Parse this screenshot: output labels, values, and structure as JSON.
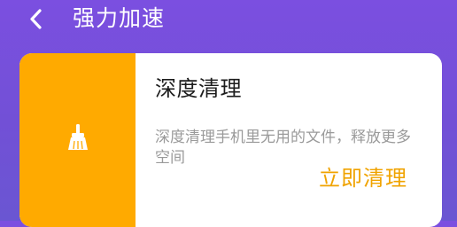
{
  "header": {
    "title": "强力加速",
    "back_icon": "chevron-left-icon"
  },
  "card": {
    "icon": "broom-icon",
    "title": "深度清理",
    "description": "深度清理手机里无用的文件，释放更多空间",
    "action_label": "立即清理"
  },
  "colors": {
    "background": "#7250d6",
    "accent": "#ffaa00",
    "action_text": "#f0a300",
    "card": "#ffffff"
  }
}
